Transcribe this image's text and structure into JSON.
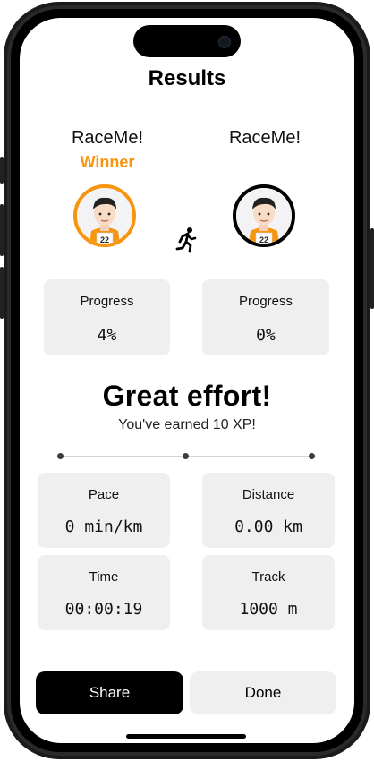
{
  "screen_title": "Results",
  "players": [
    {
      "name": "RaceMe!",
      "badge": "Winner",
      "bib": "22",
      "ring_color": "#f7950f",
      "progress_label": "Progress",
      "progress_value": "4%"
    },
    {
      "name": "RaceMe!",
      "badge": "",
      "bib": "22",
      "ring_color": "#000000",
      "progress_label": "Progress",
      "progress_value": "0%"
    }
  ],
  "headline": "Great effort!",
  "xp_message": "You've earned 10 XP!",
  "stats": {
    "pace": {
      "label": "Pace",
      "value": "0 min/km"
    },
    "distance": {
      "label": "Distance",
      "value": "0.00 km"
    },
    "time": {
      "label": "Time",
      "value": "00:00:19"
    },
    "track": {
      "label": "Track",
      "value": "1000 m"
    }
  },
  "buttons": {
    "share": "Share",
    "done": "Done"
  },
  "colors": {
    "accent": "#f7950f",
    "card_bg": "#efefef",
    "primary_button": "#000000"
  }
}
